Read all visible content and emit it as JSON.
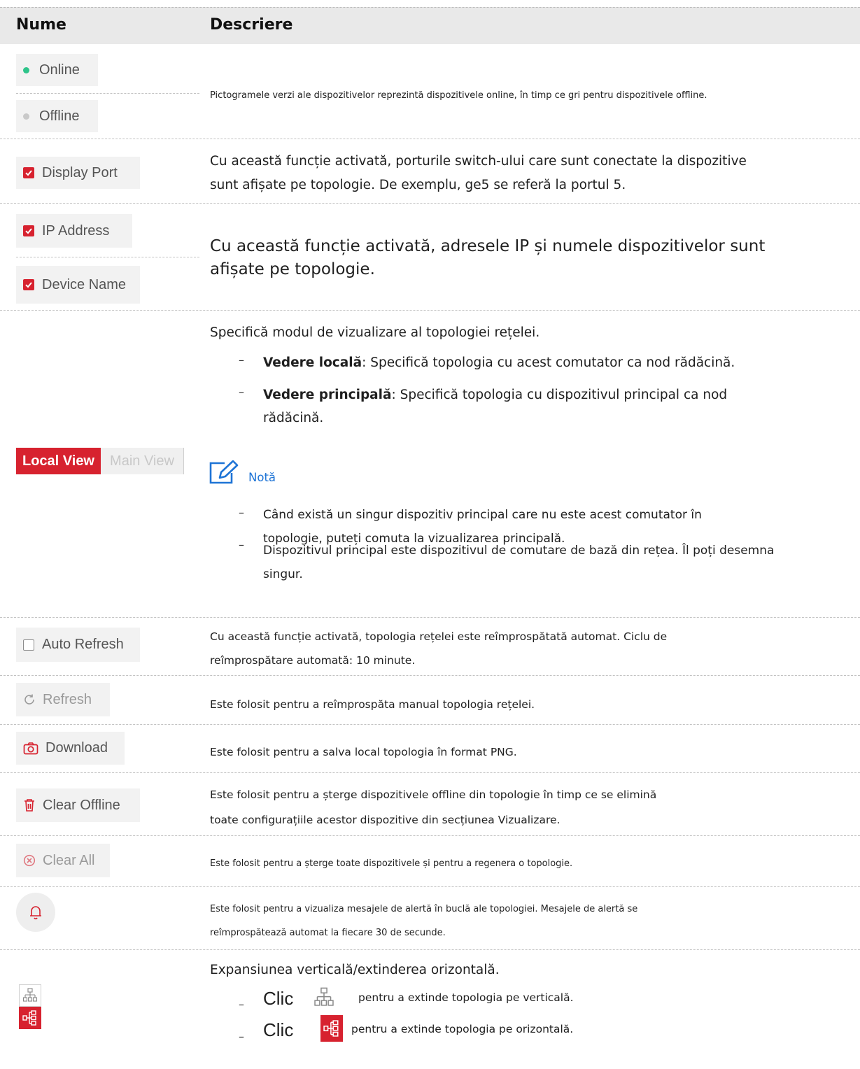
{
  "header": {
    "col1": "Nume",
    "col2": "Descriere"
  },
  "colors": {
    "accent": "#d7222f",
    "online": "#2ec48a",
    "offline": "#c9c9c9",
    "note_blue": "#1e74d6"
  },
  "rows": {
    "status": {
      "online_label": "Online",
      "offline_label": "Offline",
      "desc": "Pictogramele verzi ale dispozitivelor reprezintă dispozitivele online, în timp ce gri pentru dispozitivele offline."
    },
    "display_port": {
      "label": "Display Port",
      "desc_line1": "Cu această funcție activată, porturile switch-ului care sunt conectate la dispozitive",
      "desc_line2": "sunt afișate pe topologie. De exemplu, ge5 se referă la portul 5."
    },
    "ip_name": {
      "ip_label": "IP Address",
      "name_label": "Device Name",
      "desc_line1": "Cu această funcție activată, adresele IP și numele dispozitivelor sunt",
      "desc_line2": "afișate pe topologie."
    },
    "view": {
      "local_label": "Local View",
      "main_label": "Main View",
      "intro": "Specifică modul de vizualizare al topologiei rețelei.",
      "b1_term": "Vedere locală",
      "b1_text": ": Specifică topologia cu acest comutator ca nod rădăcină.",
      "b2_term": "Vedere principală",
      "b2_text": ": Specifică topologia cu dispozitivul principal ca nod",
      "b2_line2": "rădăcină.",
      "note_title": "Notă",
      "n1_line1": "Când există un singur dispozitiv principal care nu este acest comutator în",
      "n1_line2": "topologie, puteți comuta la vizualizarea principală.",
      "n2_line1": "Dispozitivul principal este dispozitivul de comutare de bază din rețea. Îl poți desemna",
      "n2_line2": "singur."
    },
    "auto_refresh": {
      "label": "Auto Refresh",
      "desc_line1": "Cu această funcție activată, topologia rețelei este reîmprospătată automat. Ciclu de",
      "desc_line2": "reîmprospătare automată: 10 minute."
    },
    "refresh": {
      "label": "Refresh",
      "desc": "Este folosit pentru a reîmprospăta manual topologia rețelei."
    },
    "download": {
      "label": "Download",
      "desc": "Este folosit pentru a salva local topologia în format PNG."
    },
    "clear_offline": {
      "label": "Clear Offline",
      "desc_line1": "Este folosit pentru a șterge dispozitivele offline din topologie în timp ce se elimină",
      "desc_line2": "toate configurațiile acestor dispozitive din secțiunea Vizualizare."
    },
    "clear_all": {
      "label": "Clear All",
      "desc": "Este folosit pentru a șterge toate dispozitivele și pentru a regenera o topologie."
    },
    "alert": {
      "icon": "bell-icon",
      "desc_line1": "Este folosit pentru a vizualiza mesajele de alertă în buclă ale topologiei. Mesajele de alertă se",
      "desc_line2": "reîmprospătează automat la fiecare 30 de secunde."
    },
    "expand": {
      "intro": "Expansiunea verticală/extinderea orizontală.",
      "clic": "Clic",
      "v_text": "pentru a extinde topologia pe verticală.",
      "h_text": "pentru a extinde topologia pe orizontală."
    }
  },
  "bullet_char": "–"
}
